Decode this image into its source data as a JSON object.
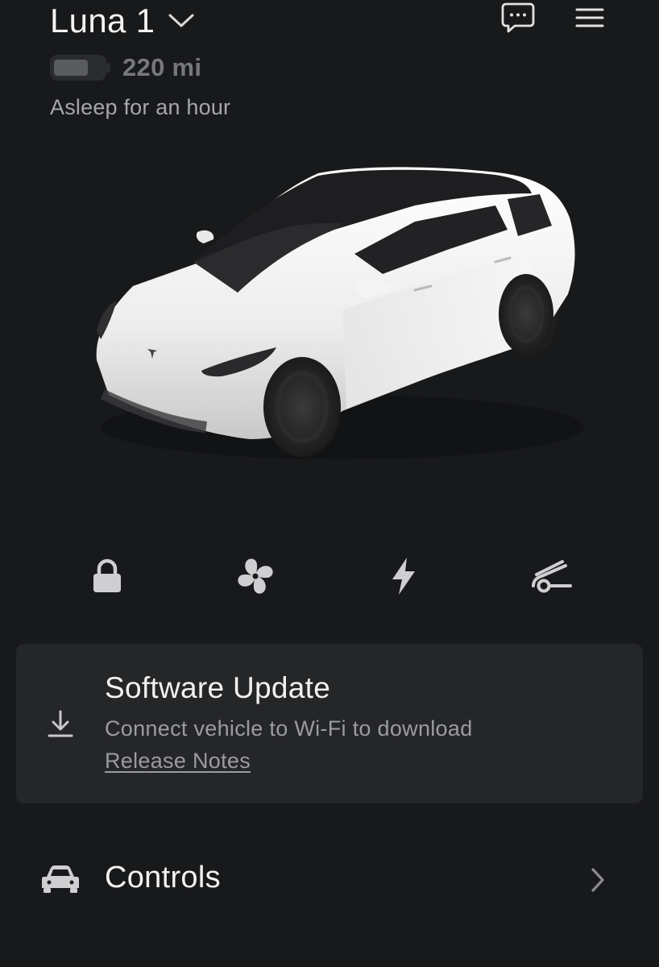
{
  "header": {
    "vehicle_name": "Luna 1",
    "range": "220 mi",
    "battery_level": 0.7,
    "status": "Asleep for an hour",
    "icons": [
      "chevron-down-icon",
      "message-icon",
      "menu-icon"
    ]
  },
  "quick_actions": [
    {
      "name": "lock",
      "icon": "lock-icon"
    },
    {
      "name": "climate",
      "icon": "fan-icon"
    },
    {
      "name": "charge",
      "icon": "lightning-icon"
    },
    {
      "name": "frunk",
      "icon": "frunk-icon"
    }
  ],
  "software_update": {
    "title": "Software Update",
    "message": "Connect vehicle to Wi-Fi to download",
    "link_label": "Release Notes",
    "icon": "download-icon"
  },
  "controls": {
    "label": "Controls",
    "icon": "car-icon"
  },
  "colors": {
    "background": "#18191b",
    "card": "#252628",
    "primary_text": "#f1f1f1",
    "secondary_text": "#9b9c9f",
    "icon": "#c9c9cb",
    "car_body": "#f2f2f2"
  }
}
